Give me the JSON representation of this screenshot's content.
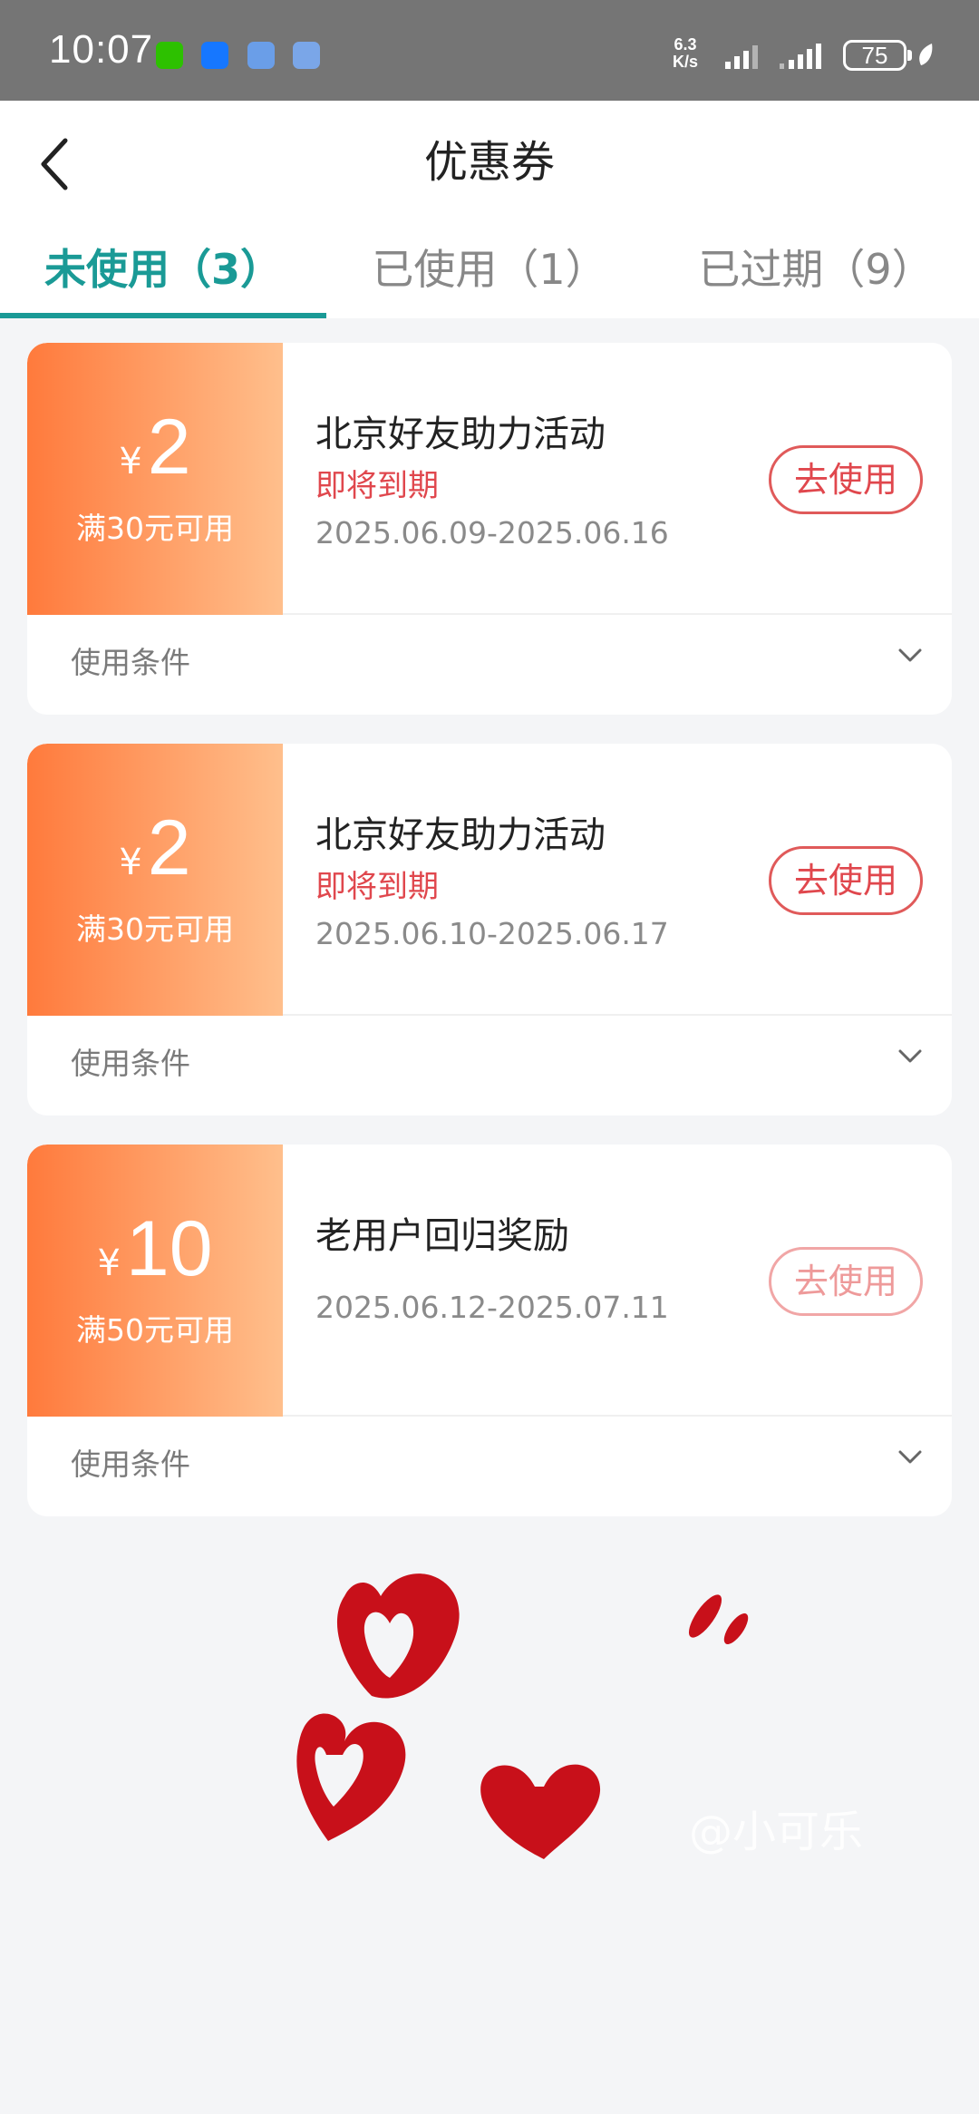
{
  "status_bar": {
    "time": "10:07",
    "net_speed_value": "6.3",
    "net_speed_unit": "K/s",
    "battery": "75"
  },
  "header": {
    "title": "优惠券"
  },
  "tabs": [
    {
      "label": "未使用（3）",
      "active": true
    },
    {
      "label": "已使用（1）",
      "active": false
    },
    {
      "label": "已过期（9）",
      "active": false
    }
  ],
  "coupons": [
    {
      "currency": "¥",
      "amount": "2",
      "threshold": "满30元可用",
      "name": "北京好友助力活动",
      "tag": "即将到期",
      "date_range": "2025.06.09-2025.06.16",
      "button": "去使用",
      "conditions_label": "使用条件"
    },
    {
      "currency": "¥",
      "amount": "2",
      "threshold": "满30元可用",
      "name": "北京好友助力活动",
      "tag": "即将到期",
      "date_range": "2025.06.10-2025.06.17",
      "button": "去使用",
      "conditions_label": "使用条件"
    },
    {
      "currency": "¥",
      "amount": "10",
      "threshold": "满50元可用",
      "name": "老用户回归奖励",
      "tag": "",
      "date_range": "2025.06.12-2025.07.11",
      "button": "去使用",
      "conditions_label": "使用条件"
    }
  ],
  "watermark": "@小可乐",
  "colors": {
    "accent": "#1a9a96",
    "coupon_gradient_start": "#ff7a3c",
    "coupon_gradient_end": "#ffbf8c",
    "alert_red": "#e0474d",
    "heart_red": "#c8101a"
  }
}
